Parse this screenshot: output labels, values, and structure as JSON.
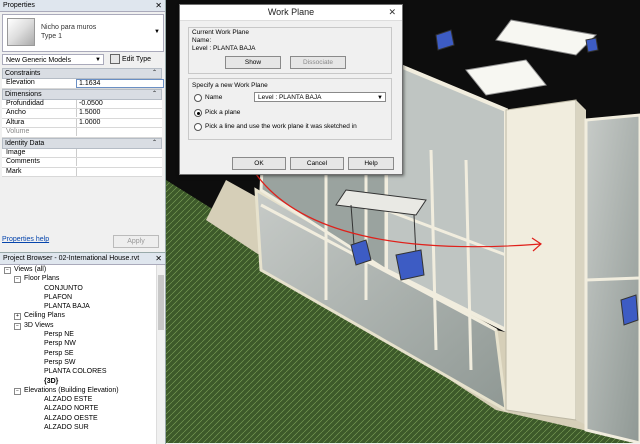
{
  "properties": {
    "title": "Properties",
    "close_glyph": "✕",
    "type_name": "Nicho para muros",
    "type_sub": "Type 1",
    "family_select": "New Generic Models",
    "edit_type": "Edit Type",
    "sections": {
      "constraints": "Constraints",
      "dimensions": "Dimensions",
      "identity": "Identity Data"
    },
    "rows": {
      "elevation": {
        "k": "Elevation",
        "v": "1.1634"
      },
      "profundidad": {
        "k": "Profundidad",
        "v": "-0.0500"
      },
      "ancho": {
        "k": "Ancho",
        "v": "1.5000"
      },
      "altura": {
        "k": "Altura",
        "v": "1.0000"
      },
      "volume": {
        "k": "Volume",
        "v": ""
      },
      "image": {
        "k": "Image",
        "v": ""
      },
      "comments": {
        "k": "Comments",
        "v": ""
      },
      "mark": {
        "k": "Mark",
        "v": ""
      }
    },
    "help": "Properties help",
    "apply": "Apply"
  },
  "browser": {
    "title": "Project Browser - 02-International House.rvt",
    "nodes": [
      {
        "label": "Views (all)",
        "depth": 0,
        "pm": "−"
      },
      {
        "label": "Floor Plans",
        "depth": 1,
        "pm": "−"
      },
      {
        "label": "CONJUNTO",
        "depth": 2,
        "pm": ""
      },
      {
        "label": "PLAFON",
        "depth": 2,
        "pm": ""
      },
      {
        "label": "PLANTA BAJA",
        "depth": 2,
        "pm": ""
      },
      {
        "label": "Ceiling Plans",
        "depth": 1,
        "pm": "+"
      },
      {
        "label": "3D Views",
        "depth": 1,
        "pm": "−"
      },
      {
        "label": "Persp NE",
        "depth": 2,
        "pm": ""
      },
      {
        "label": "Persp NW",
        "depth": 2,
        "pm": ""
      },
      {
        "label": "Persp SE",
        "depth": 2,
        "pm": ""
      },
      {
        "label": "Persp SW",
        "depth": 2,
        "pm": ""
      },
      {
        "label": "PLANTA COLORES",
        "depth": 2,
        "pm": ""
      },
      {
        "label": "{3D}",
        "depth": 2,
        "pm": "",
        "bold": true
      },
      {
        "label": "Elevations (Building Elevation)",
        "depth": 1,
        "pm": "−"
      },
      {
        "label": "ALZADO ESTE",
        "depth": 2,
        "pm": ""
      },
      {
        "label": "ALZADO NORTE",
        "depth": 2,
        "pm": ""
      },
      {
        "label": "ALZADO OESTE",
        "depth": 2,
        "pm": ""
      },
      {
        "label": "ALZADO SUR",
        "depth": 2,
        "pm": ""
      }
    ]
  },
  "dialog": {
    "title": "Work Plane",
    "close_glyph": "✕",
    "current_group": "Current Work Plane",
    "name_label": "Name:",
    "current_name": "Level : PLANTA BAJA",
    "show": "Show",
    "dissociate": "Dissociate",
    "specify_group": "Specify a new Work Plane",
    "opt_name": "Name",
    "opt_name_value": "Level : PLANTA BAJA",
    "opt_pick_plane": "Pick a plane",
    "opt_pick_line": "Pick a line and use the work plane it was sketched in",
    "selected_option": "opt_pick_plane",
    "ok": "OK",
    "cancel": "Cancel",
    "help": "Help"
  },
  "colors": {
    "annotation_arrow": "#e0201a",
    "viewport_bg": "#0d0d0d",
    "building_wall": "#f1edde",
    "selection_blue": "#3d5cc4"
  }
}
